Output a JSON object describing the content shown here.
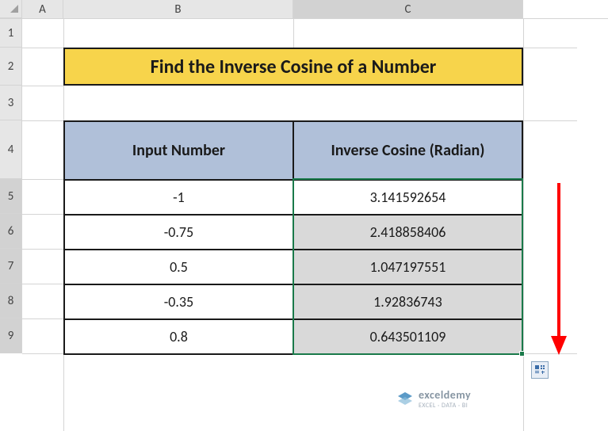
{
  "columns": {
    "A": "A",
    "B": "B",
    "C": "C"
  },
  "rows": {
    "r1": "1",
    "r2": "2",
    "r3": "3",
    "r4": "4",
    "r5": "5",
    "r6": "6",
    "r7": "7",
    "r8": "8",
    "r9": "9"
  },
  "title": "Find the Inverse Cosine of a Number",
  "headers": {
    "input": "Input Number",
    "result": "Inverse Cosine (Radian)"
  },
  "chart_data": {
    "type": "table",
    "title": "Find the Inverse Cosine of a Number",
    "columns": [
      "Input Number",
      "Inverse Cosine (Radian)"
    ],
    "rows": [
      {
        "input": -1,
        "result": 3.141592654
      },
      {
        "input": -0.75,
        "result": 2.418858406
      },
      {
        "input": 0.5,
        "result": 1.047197551
      },
      {
        "input": -0.35,
        "result": 1.92836743
      },
      {
        "input": 0.8,
        "result": 0.643501109
      }
    ]
  },
  "table": [
    {
      "input": "-1",
      "result": "3.141592654"
    },
    {
      "input": "-0.75",
      "result": "2.418858406"
    },
    {
      "input": "0.5",
      "result": "1.047197551"
    },
    {
      "input": "-0.35",
      "result": "1.92836743"
    },
    {
      "input": "0.8",
      "result": "0.643501109"
    }
  ],
  "watermark": {
    "brand": "exceldemy",
    "sub": "EXCEL · DATA · BI"
  },
  "selection": {
    "active_column": "C",
    "active_rows": [
      "5",
      "6",
      "7",
      "8",
      "9"
    ]
  }
}
